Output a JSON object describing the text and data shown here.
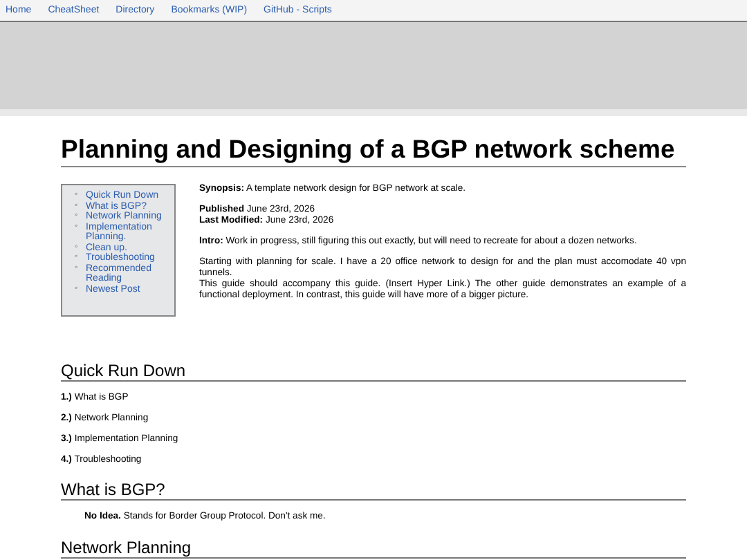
{
  "nav": [
    {
      "label": "Home"
    },
    {
      "label": "CheatSheet"
    },
    {
      "label": "Directory"
    },
    {
      "label": "Bookmarks (WIP)"
    },
    {
      "label": "GitHub - Scripts"
    }
  ],
  "title": "Planning and Designing of a BGP network scheme",
  "toc": [
    {
      "marker": "◦",
      "label": "Quick Run Down"
    },
    {
      "marker": "◦",
      "label": "What is BGP?"
    },
    {
      "marker": "◦",
      "label": "Network Planning"
    },
    {
      "marker": "◦",
      "label": "Implementation Planning."
    },
    {
      "marker": "◦",
      "label": "Clean up."
    },
    {
      "marker": "◦",
      "label": "Troubleshooting"
    },
    {
      "marker": "◦",
      "label": "Recommended Reading"
    },
    {
      "marker": "◦",
      "label": "Newest Post"
    }
  ],
  "intro": [
    "**Synopsis:** A template network design for BGP network at scale.",
    "**Published** June 23rd, 2026",
    "**Last Modified:** June 23rd, 2026",
    "**Intro:** Work in progress, still figuring this out exactly, but will need to recreate for about a dozen networks.",
    "Starting with planning for scale. I have a 20 office network to design for and the plan must accomodate 40 vpn tunnels.",
    "This guide should accompany this guide. (Insert Hyper Link.) The other guide demonstrates an example of a functional deployment. In contrast, this guide will have more of a bigger picture."
  ],
  "sections": [
    {
      "heading": "Quick Run Down",
      "kind": "list",
      "items": [
        "**1.)** What is BGP",
        "**2.)** Network Planning",
        "**3.)** Implementation Planning",
        "**4.)** Troubleshooting"
      ]
    },
    {
      "heading": "What is BGP?",
      "kind": "para",
      "items": [
        "**No Idea.** Stands for Border Group Protocol. Don't ask me."
      ]
    },
    {
      "heading": "Network Planning",
      "kind": "list"
    }
  ]
}
